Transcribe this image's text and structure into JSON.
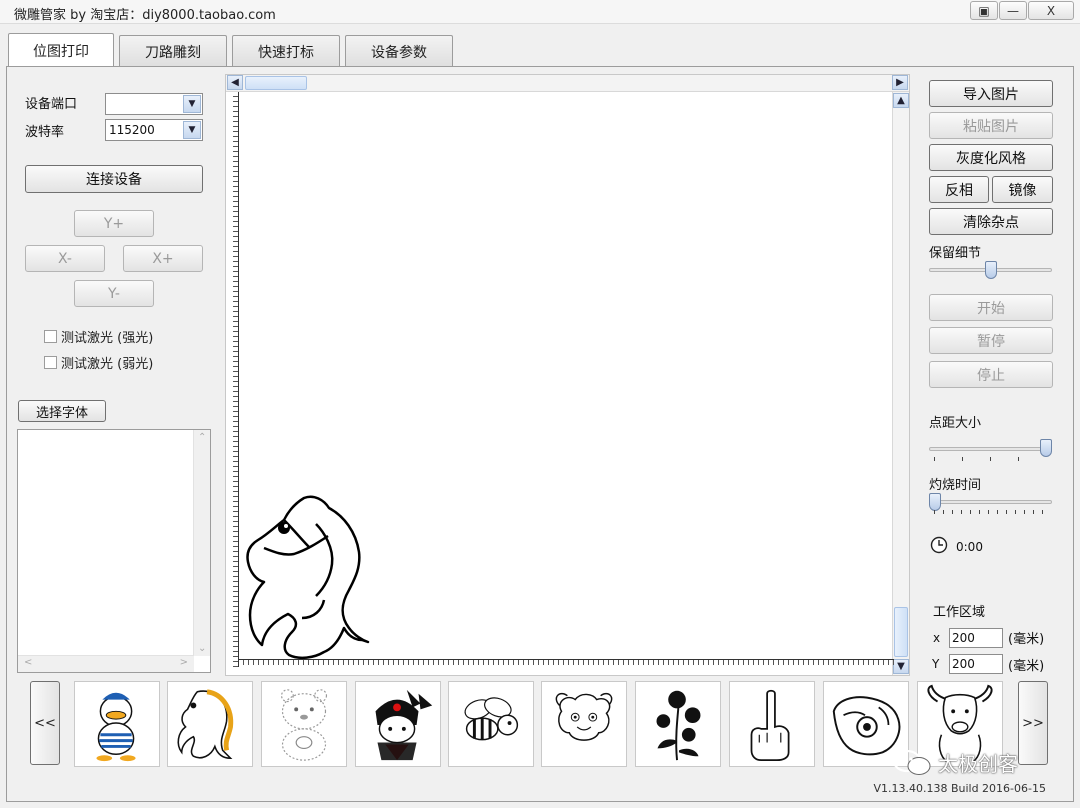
{
  "window": {
    "title": "微雕管家 by 淘宝店：diy8000.taobao.com",
    "buttons": [
      "▣",
      "—",
      "X"
    ]
  },
  "tabs": [
    "位图打印",
    "刀路雕刻",
    "快速打标",
    "设备参数"
  ],
  "left_panel": {
    "port_label": "设备端口",
    "port_value": "",
    "baud_label": "波特率",
    "baud_value": "115200",
    "connect_button": "连接设备",
    "jog": {
      "y_plus": "Y+",
      "x_minus": "X-",
      "x_plus": "X+",
      "y_minus": "Y-"
    },
    "test_strong": "测试激光 (强光)",
    "test_weak": "测试激光 (弱光)",
    "font_button": "选择字体"
  },
  "right_panel": {
    "import_button": "导入图片",
    "paste_button": "粘贴图片",
    "grayscale_button": "灰度化风格",
    "invert_button": "反相",
    "mirror_button": "镜像",
    "denoise_button": "清除杂点",
    "detail_label": "保留细节",
    "detail_level": 0.5,
    "start_button": "开始",
    "pause_button": "暂停",
    "stop_button": "停止",
    "dot_size_label": "点距大小",
    "dot_size_level": 1.0,
    "burn_time_label": "灼烧时间",
    "burn_time_level": 0.0,
    "timer_value": "0:00",
    "work_area_label": "工作区域",
    "x_label": "x",
    "x_value": "200",
    "y_label": "Y",
    "y_value": "200",
    "unit": "(毫米)"
  },
  "thumbnails": {
    "prev_button": "<<",
    "next_button": ">>",
    "items": [
      "duck-icon",
      "horse-color-icon",
      "bear-icon",
      "rabbit-icon",
      "bee-icon",
      "sheep-icon",
      "rose-icon",
      "finger-icon",
      "pointing-hand-icon",
      "bull-icon"
    ]
  },
  "version": "V1.13.40.138 Build 2016-06-15",
  "watermark": "太极创客"
}
